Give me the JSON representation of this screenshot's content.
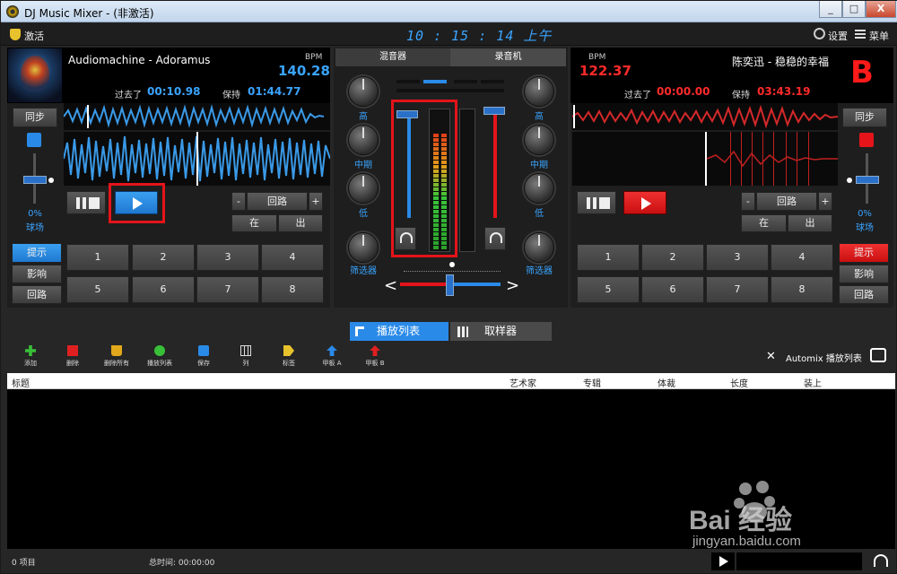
{
  "window": {
    "title": "DJ Music Mixer - (非激活)",
    "min": "_",
    "restore": "□",
    "close": "X"
  },
  "topbar": {
    "activate": "激活",
    "clock": "10 : 15 : 14 上午",
    "settings": "设置",
    "menu": "菜单"
  },
  "deckA": {
    "title": "Audiomachine - Adoramus",
    "bpm_label": "BPM",
    "bpm": "140.28",
    "elapsed_label": "过去了",
    "elapsed": "00:10.98",
    "remain_label": "保持",
    "remain": "01:44.77",
    "sync": "同步",
    "pitch": "0%",
    "pitch_label": "球场",
    "cue": "提示",
    "effect": "影响",
    "loop_side": "回路",
    "loop": "回路",
    "minus": "-",
    "plus": "+",
    "in": "在",
    "out": "出",
    "pads": [
      "1",
      "2",
      "3",
      "4",
      "5",
      "6",
      "7",
      "8"
    ]
  },
  "deckB": {
    "title": "陈奕迅 - 稳稳的幸福",
    "bpm_label": "BPM",
    "bpm": "122.37",
    "elapsed_label": "过去了",
    "elapsed": "00:00.00",
    "remain_label": "保持",
    "remain": "03:43.19",
    "letter": "B",
    "sync": "同步",
    "pitch": "0%",
    "pitch_label": "球场",
    "cue": "提示",
    "effect": "影响",
    "loop_side": "回路",
    "loop": "回路",
    "minus": "-",
    "plus": "+",
    "in": "在",
    "out": "出",
    "pads": [
      "1",
      "2",
      "3",
      "4",
      "5",
      "6",
      "7",
      "8"
    ]
  },
  "mixer": {
    "tab_mixer": "混音器",
    "tab_recorder": "录音机",
    "high": "高",
    "mid": "中期",
    "low": "低",
    "filter": "筛选器",
    "crossfader_left": "<",
    "crossfader_right": ">"
  },
  "tabs": {
    "playlist": "播放列表",
    "sampler": "取样器"
  },
  "toolbar": {
    "add": "添加",
    "delete": "删除",
    "delete_all": "删除所有",
    "playlist": "播放列表",
    "save": "保存",
    "columns": "列",
    "tag": "标签",
    "deck_a": "甲板 A",
    "deck_b": "甲板 B",
    "automix": "Automix 播放列表"
  },
  "grid": {
    "columns": [
      "标题",
      "艺术家",
      "专辑",
      "体裁",
      "长度",
      "装上"
    ]
  },
  "status": {
    "items": "0 项目",
    "total": "总时间: 00:00:00"
  },
  "watermark": {
    "brand": "Bai 经验",
    "url": "jingyan.baidu.com"
  },
  "colors": {
    "accent_blue": "#3aa4ff",
    "accent_red": "#ff1a1a",
    "highlight_box": "#e4141a"
  }
}
